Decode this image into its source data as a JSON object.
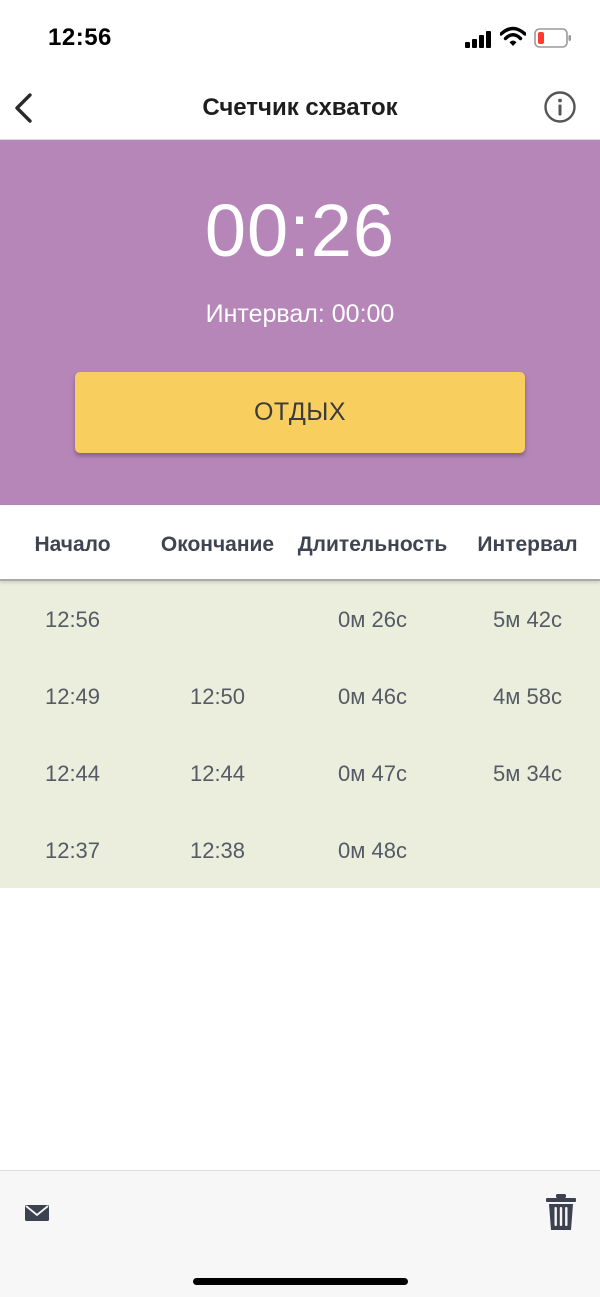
{
  "status_bar": {
    "time": "12:56",
    "icons": [
      "cellular-signal-icon",
      "wifi-icon",
      "battery-low-icon"
    ]
  },
  "nav": {
    "title": "Счетчик схваток",
    "back_icon": "chevron-left-icon",
    "info_icon": "info-icon"
  },
  "timer": {
    "elapsed": "00:26",
    "interval_text": "Интервал: 00:00",
    "button_label": "ОТДЫХ"
  },
  "table": {
    "headers": [
      "Начало",
      "Окончание",
      "Длительность",
      "Интервал"
    ],
    "rows": [
      [
        "12:56",
        "",
        "0м 26с",
        "5м 42с"
      ],
      [
        "12:49",
        "12:50",
        "0м 46с",
        "4м 58с"
      ],
      [
        "12:44",
        "12:44",
        "0м 47с",
        "5м 34с"
      ],
      [
        "12:37",
        "12:38",
        "0м 48с",
        ""
      ]
    ]
  },
  "toolbar": {
    "mail_icon": "mail-icon",
    "trash_icon": "trash-icon"
  },
  "colors": {
    "timer_background": "#b686b9",
    "button_background": "#f8cf5f",
    "table_body_background": "#ebeedc"
  }
}
